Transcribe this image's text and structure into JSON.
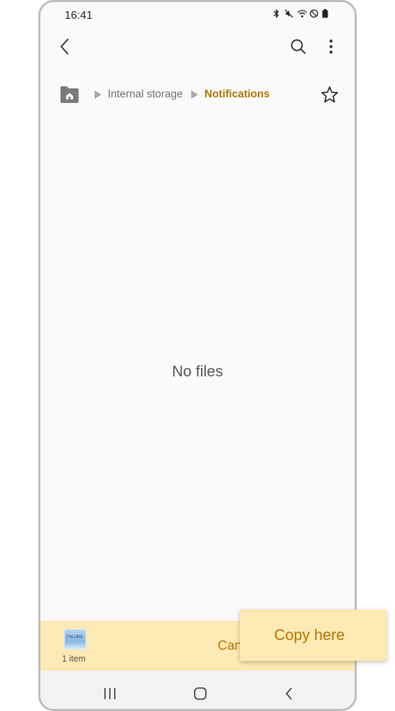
{
  "status": {
    "time": "16:41",
    "icons": [
      "bluetooth-icon",
      "mute-icon",
      "wifi-icon",
      "do-not-disturb-icon",
      "battery-icon"
    ]
  },
  "toolbar": {
    "back_icon": "back-arrow-icon",
    "search_icon": "search-icon",
    "more_icon": "more-options-icon"
  },
  "breadcrumb": {
    "home_icon": "home-folder-icon",
    "items": [
      "Internal storage",
      "Notifications"
    ],
    "favorite_icon": "star-icon"
  },
  "main": {
    "empty_message": "No files"
  },
  "bottom": {
    "item_count": "1 item",
    "cancel_label": "Can",
    "thumbnail_text": "FALLING"
  },
  "popup": {
    "copy_here_label": "Copy here"
  },
  "nav": {
    "recent_icon": "recent-apps-icon",
    "home_icon": "home-button-icon",
    "back_icon": "back-button-icon"
  },
  "colors": {
    "accent": "#b27400",
    "panel": "#fde9b3",
    "background": "#fafafa"
  }
}
